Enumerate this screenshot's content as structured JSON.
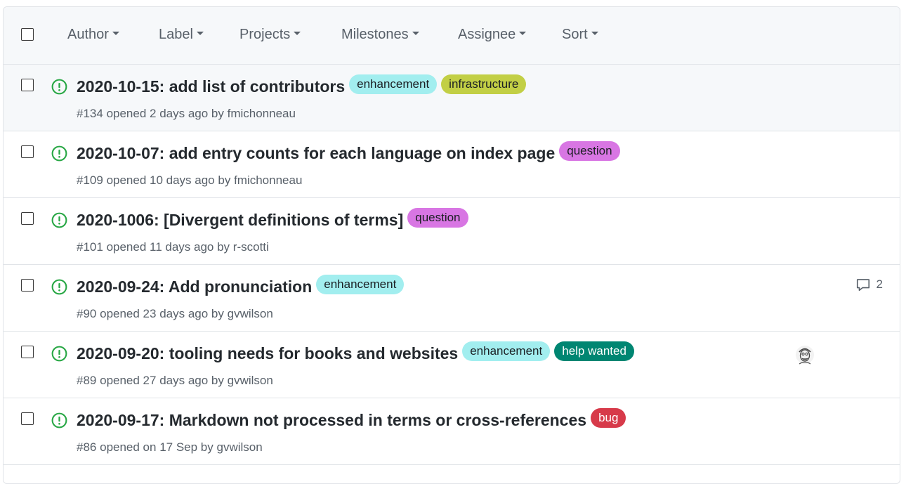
{
  "filters": [
    {
      "label": "Author"
    },
    {
      "label": "Label"
    },
    {
      "label": "Projects"
    },
    {
      "label": "Milestones"
    },
    {
      "label": "Assignee"
    },
    {
      "label": "Sort"
    }
  ],
  "colors": {
    "open_icon": "#28a745",
    "enhancement": "#a2eeef",
    "infrastructure": "#c2cf45",
    "question": "#d876e3",
    "help_wanted": "#008672",
    "bug": "#d73a4a"
  },
  "issues": [
    {
      "title": "2020-10-15: add list of contributors",
      "labels": [
        "enhancement",
        "infrastructure"
      ],
      "number": "#134",
      "opened": "opened 2 days ago by",
      "author": "fmichonneau"
    },
    {
      "title": "2020-10-07: add entry counts for each language on index page",
      "labels": [
        "question"
      ],
      "number": "#109",
      "opened": "opened 10 days ago by",
      "author": "fmichonneau"
    },
    {
      "title": "2020-1006: [Divergent definitions of terms]",
      "labels": [
        "question"
      ],
      "number": "#101",
      "opened": "opened 11 days ago by",
      "author": "r-scotti"
    },
    {
      "title": "2020-09-24: Add pronunciation",
      "labels": [
        "enhancement"
      ],
      "number": "#90",
      "opened": "opened 23 days ago by",
      "author": "gvwilson",
      "comments": "2"
    },
    {
      "title": "2020-09-20: tooling needs for books and websites",
      "labels": [
        "enhancement",
        "help wanted"
      ],
      "number": "#89",
      "opened": "opened 27 days ago by",
      "author": "gvwilson"
    },
    {
      "title": "2020-09-17: Markdown not processed in terms or cross-references",
      "labels": [
        "bug"
      ],
      "number": "#86",
      "opened": "opened on 17 Sep by",
      "author": "gvwilson"
    }
  ]
}
